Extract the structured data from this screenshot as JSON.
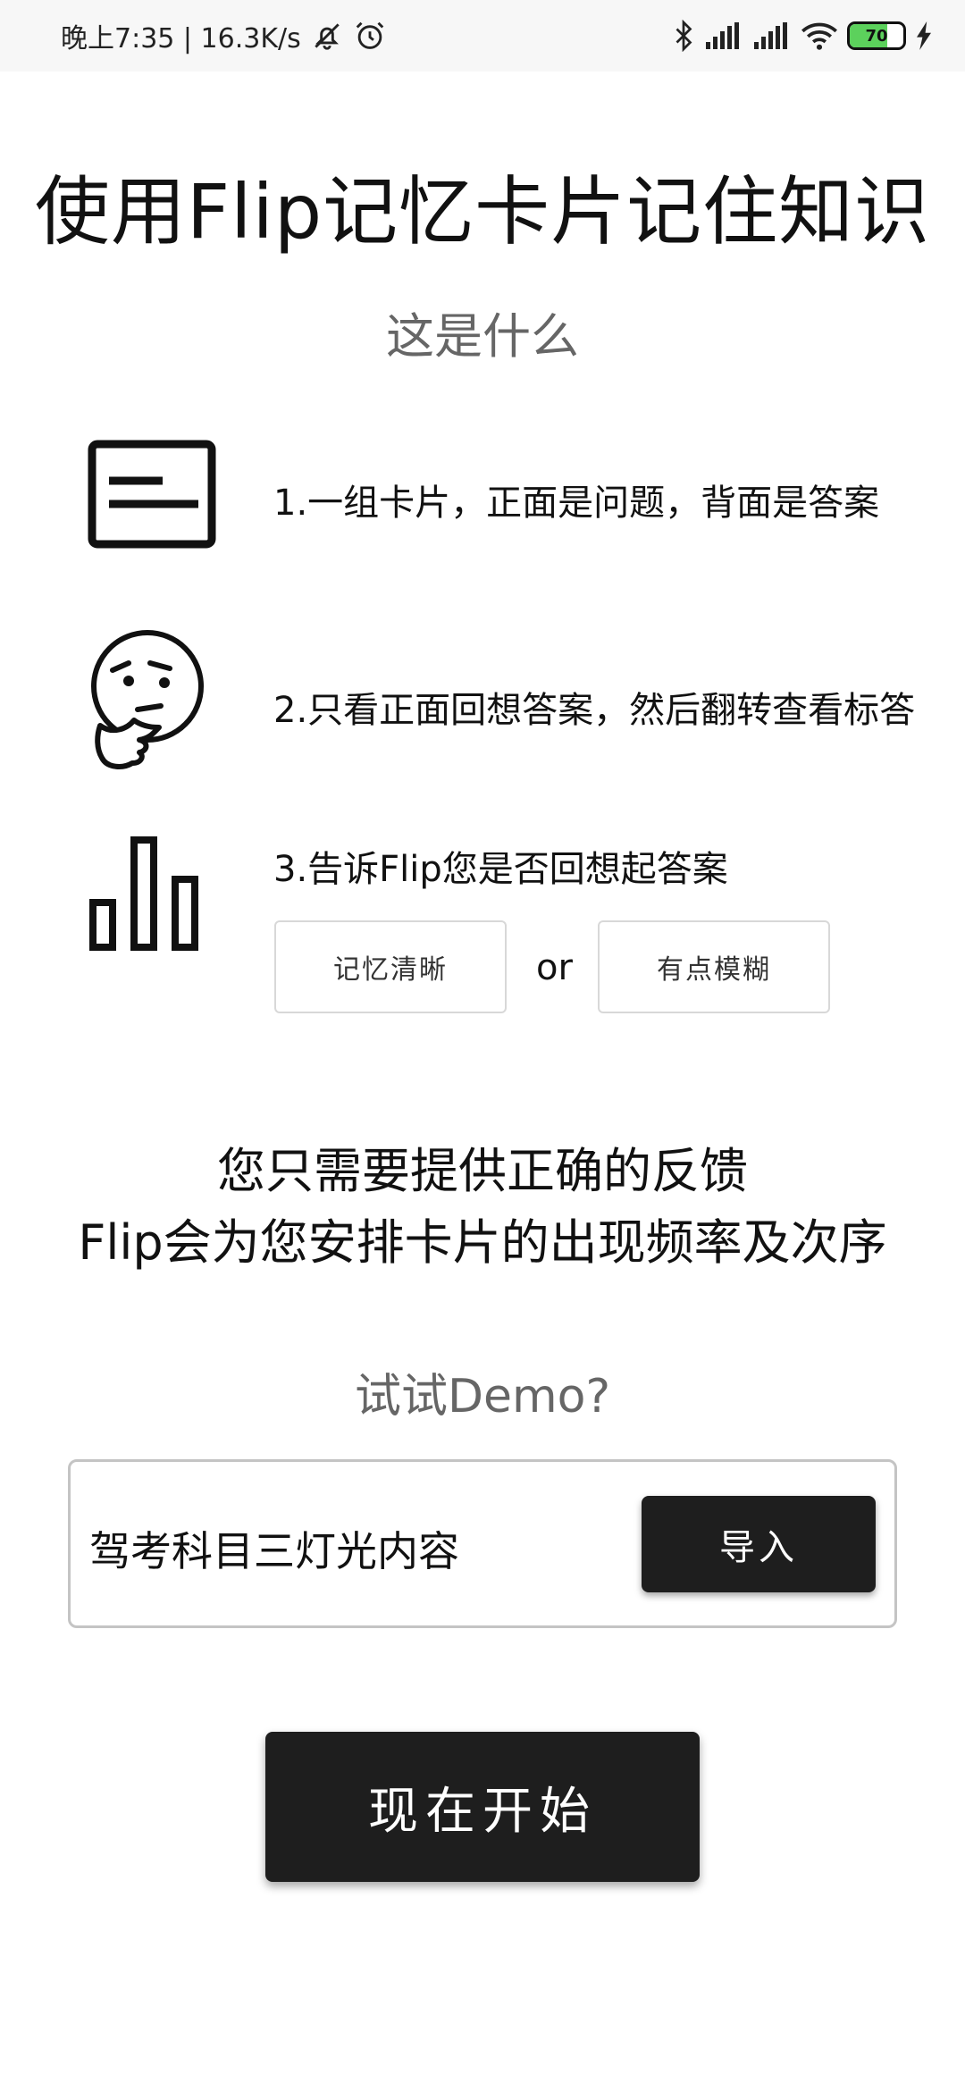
{
  "status_bar": {
    "time_speed": "晚上7:35 | 16.3K/s",
    "battery_level": "70"
  },
  "header": {
    "title": "使用Flip记忆卡片记住知识",
    "subtitle": "这是什么"
  },
  "steps": [
    {
      "icon": "card-icon",
      "text": "1.一组卡片，正面是问题，背面是答案"
    },
    {
      "icon": "thinking-face-icon",
      "text": "2.只看正面回想答案，然后翻转查看标答"
    },
    {
      "icon": "bar-chart-icon",
      "text": "3.告诉Flip您是否回想起答案"
    }
  ],
  "feedback": {
    "clear_label": "记忆清晰",
    "or_label": "or",
    "fuzzy_label": "有点模糊"
  },
  "note": {
    "line1": "您只需要提供正确的反馈",
    "line2": "Flip会为您安排卡片的出现频率及次序"
  },
  "demo": {
    "question": "试试Demo?",
    "deck_name": "驾考科目三灯光内容",
    "import_label": "导入"
  },
  "start_label": "现在开始"
}
